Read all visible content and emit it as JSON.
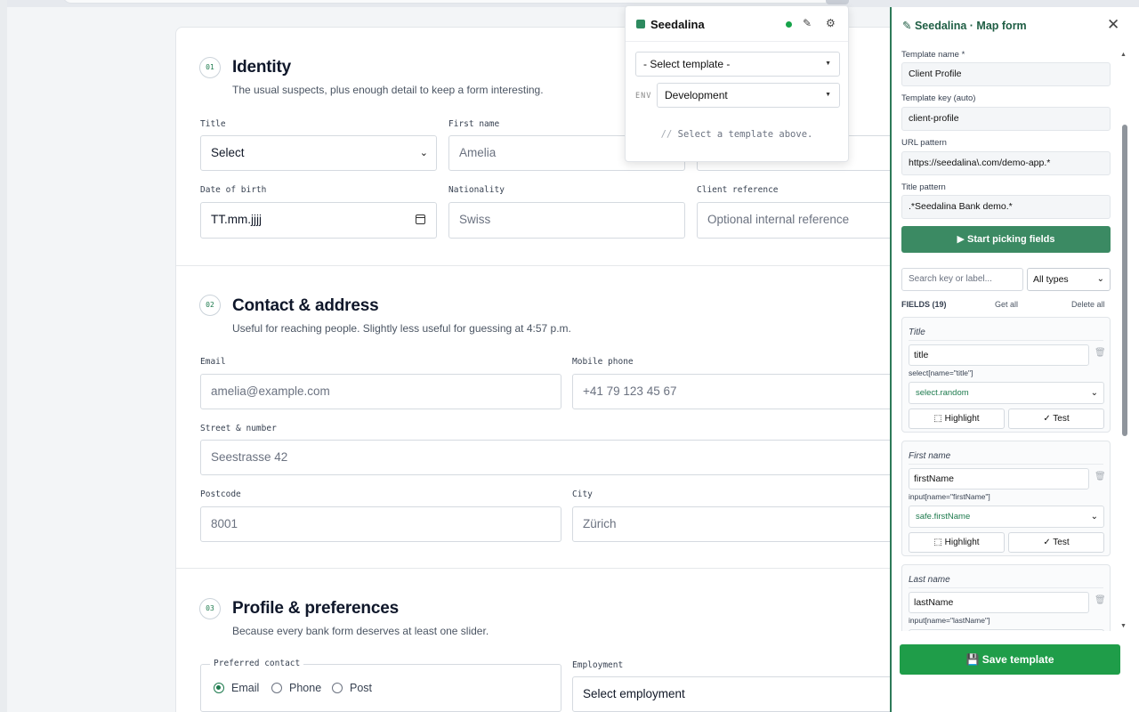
{
  "form": {
    "sections": [
      {
        "num": "01",
        "title": "Identity",
        "subtitle": "The usual suspects, plus enough detail to keep a form interesting."
      },
      {
        "num": "02",
        "title": "Contact & address",
        "subtitle": "Useful for reaching people. Slightly less useful for guessing at 4:57 p.m."
      },
      {
        "num": "03",
        "title": "Profile & preferences",
        "subtitle": "Because every bank form deserves at least one slider."
      }
    ],
    "identity": {
      "title_label": "Title",
      "title_value": "Select",
      "firstname_label": "First name",
      "firstname_placeholder": "Amelia",
      "dob_label": "Date of birth",
      "dob_value": "TT.mm.jjjj",
      "nationality_label": "Nationality",
      "nationality_placeholder": "Swiss",
      "clientref_label": "Client reference",
      "clientref_placeholder": "Optional internal reference"
    },
    "contact": {
      "email_label": "Email",
      "email_placeholder": "amelia@example.com",
      "mobile_label": "Mobile phone",
      "mobile_placeholder": "+41 79 123 45 67",
      "street_label": "Street & number",
      "street_placeholder": "Seestrasse 42",
      "postcode_label": "Postcode",
      "postcode_placeholder": "8001",
      "city_label": "City",
      "city_placeholder": "Zürich"
    },
    "profile": {
      "preferred_label": "Preferred contact",
      "options": [
        "Email",
        "Phone",
        "Post"
      ],
      "selected": "Email",
      "employment_label": "Employment",
      "employment_value": "Select employment"
    }
  },
  "popup": {
    "name": "Seedalina",
    "template_select": "- Select template -",
    "env_label": "ENV",
    "env_value": "Development",
    "hint_prefix": "//",
    "hint": "Select a template above."
  },
  "panel": {
    "title": "Seedalina · Map form",
    "template_name_label": "Template name *",
    "template_name": "Client Profile",
    "template_key_label": "Template key (auto)",
    "template_key": "client-profile",
    "url_pattern_label": "URL pattern",
    "url_pattern": "https://seedalina\\.com/demo-app.*",
    "title_pattern_label": "Title pattern",
    "title_pattern": ".*Seedalina Bank demo.*",
    "pick_button": "▶ Start picking fields",
    "search_placeholder": "Search key or label...",
    "type_filter": "All types",
    "fields_count": "FIELDS (19)",
    "get_all": "Get all",
    "delete_all": "Delete all",
    "fields": [
      {
        "label": "Title",
        "key": "title",
        "selector": "select[name=\"title\"]",
        "generator": "select.random",
        "highlight": "Highlight",
        "test": "✓ Test"
      },
      {
        "label": "First name",
        "key": "firstName",
        "selector": "input[name=\"firstName\"]",
        "generator": "safe.firstName",
        "highlight": "Highlight",
        "test": "✓ Test"
      },
      {
        "label": "Last name",
        "key": "lastName",
        "selector": "input[name=\"lastName\"]",
        "generator": "",
        "highlight": "",
        "test": ""
      }
    ],
    "save_button": "Save template"
  },
  "colors": {
    "accent": "#2d7a59",
    "save": "#1f9d49",
    "pick": "#3b8a63",
    "status_dot": "#16a34a"
  },
  "icons": {
    "edit": "pencil-icon",
    "settings": "gear-icon",
    "close": "close-icon",
    "trash": "trash-icon",
    "highlight": "highlight-icon",
    "save": "floppy-icon"
  }
}
